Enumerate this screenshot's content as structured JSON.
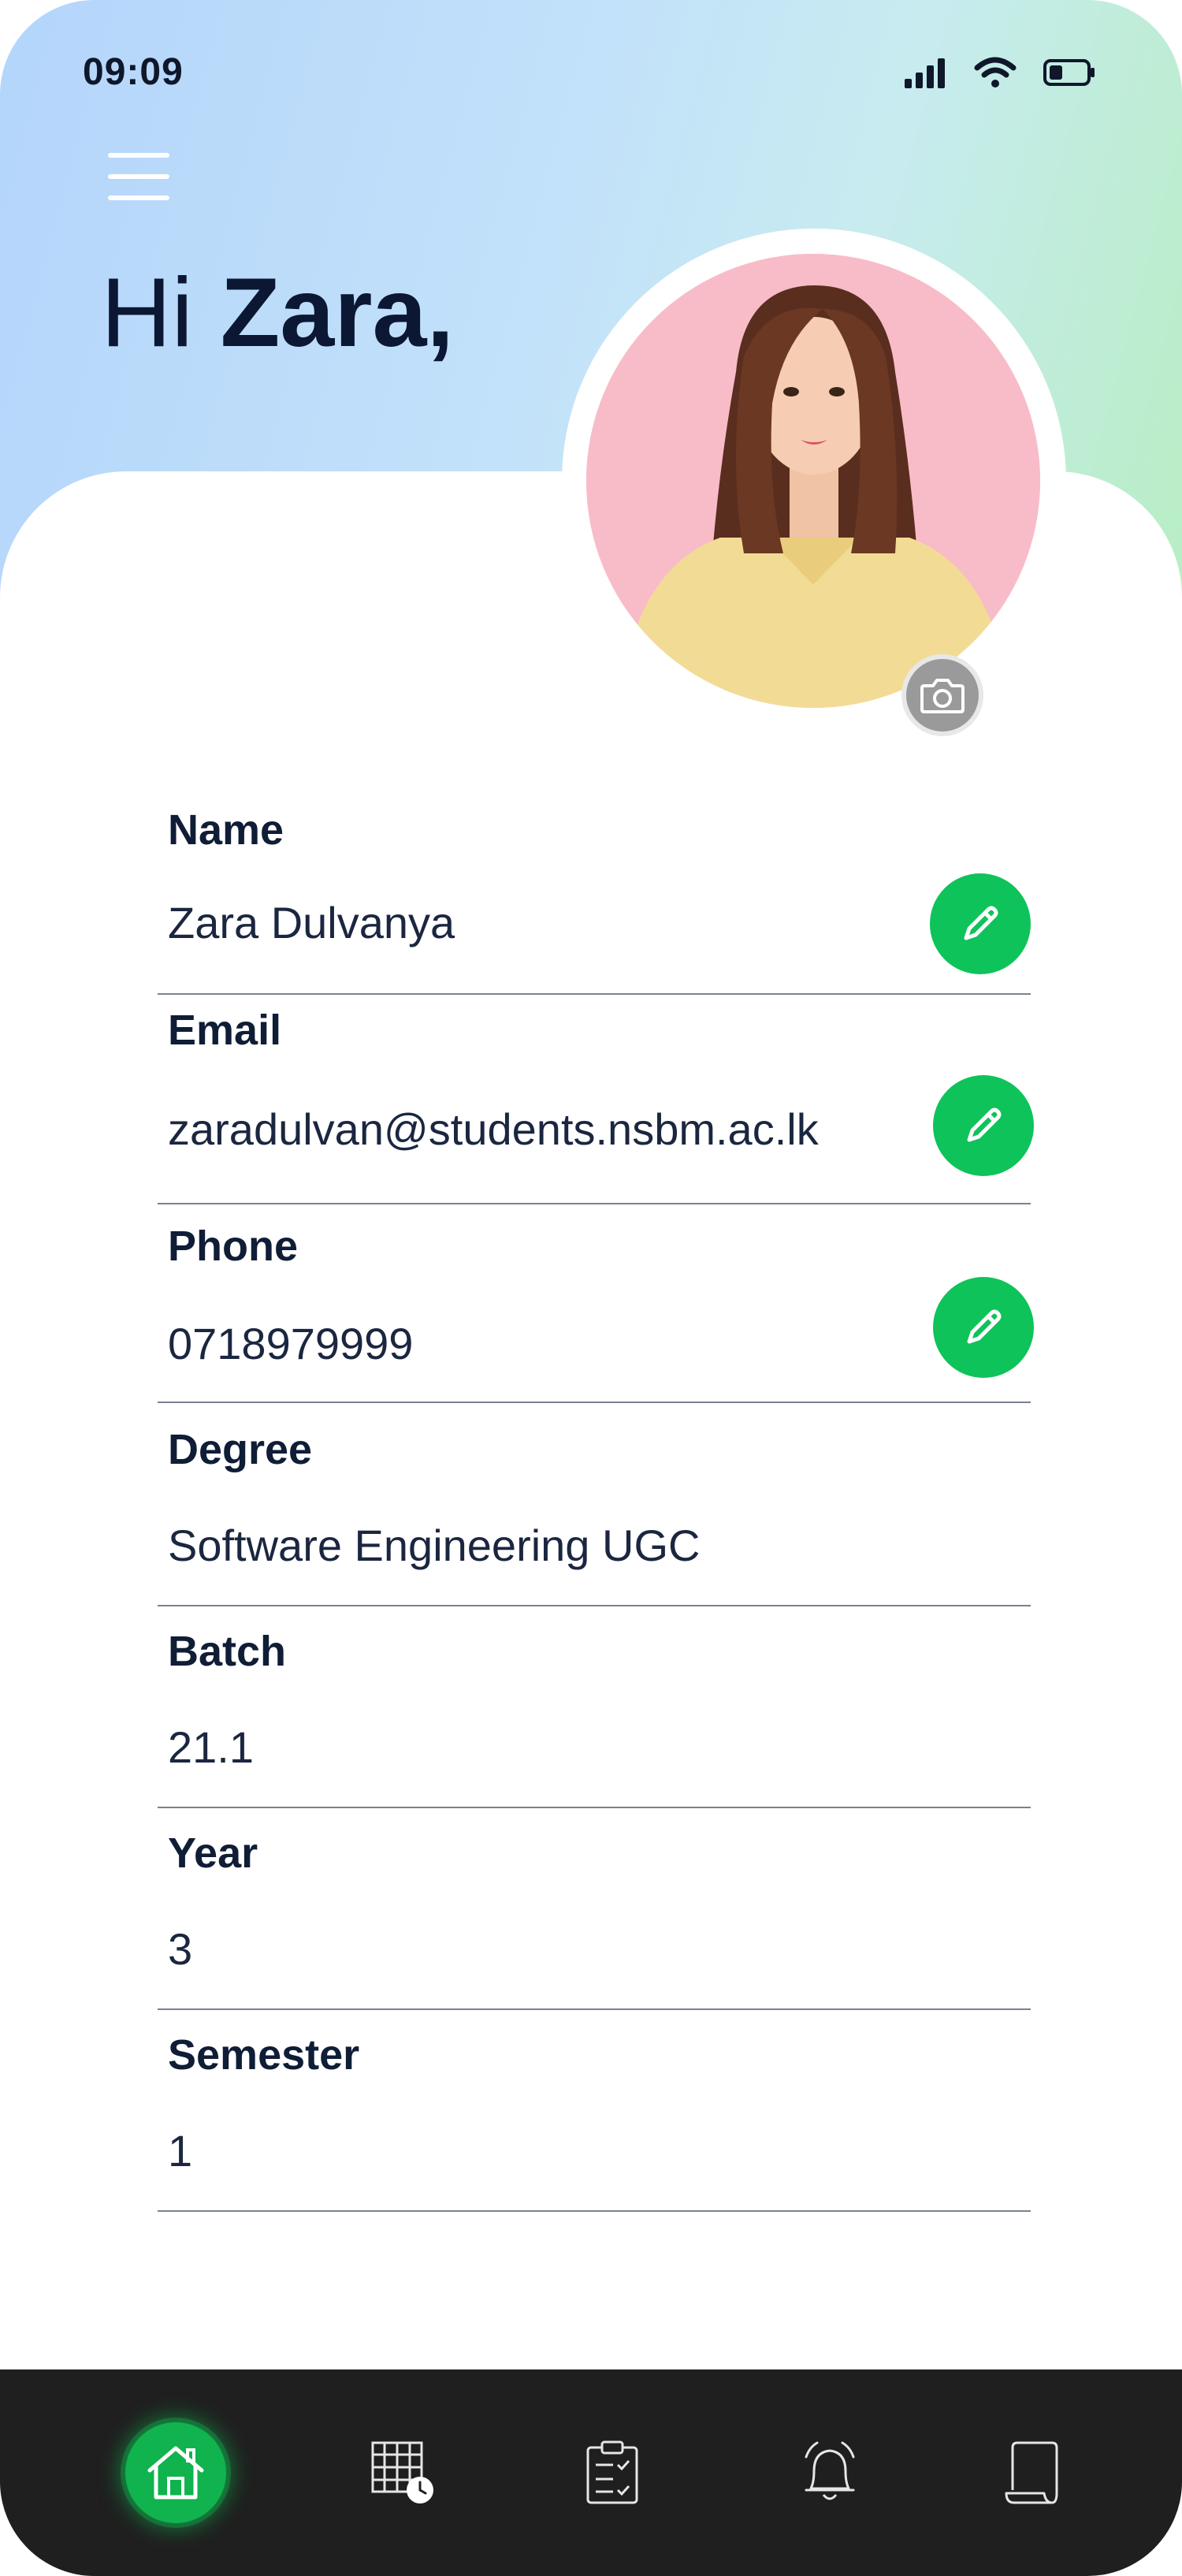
{
  "status_bar": {
    "time": "09:09",
    "icons": [
      "cellular-signal-icon",
      "wifi-icon",
      "battery-icon"
    ]
  },
  "header": {
    "greeting_prefix": "Hi",
    "greeting_name": "Zara,",
    "menu_icon": "hamburger-menu-icon"
  },
  "profile": {
    "camera_icon": "camera-icon"
  },
  "fields": [
    {
      "label": "Name",
      "value": "Zara Dulvanya",
      "editable": true
    },
    {
      "label": "Email",
      "value": "zaradulvan@students.nsbm.ac.lk",
      "editable": true
    },
    {
      "label": "Phone",
      "value": "0718979999",
      "editable": true
    },
    {
      "label": "Degree",
      "value": "Software Engineering UGC",
      "editable": false
    },
    {
      "label": "Batch",
      "value": "21.1",
      "editable": false
    },
    {
      "label": "Year",
      "value": "3",
      "editable": false
    },
    {
      "label": "Semester",
      "value": "1",
      "editable": false
    }
  ],
  "bottom_nav": {
    "items": [
      "home-icon",
      "timetable-icon",
      "tasks-clipboard-icon",
      "notifications-bell-icon",
      "documents-scroll-icon"
    ],
    "active": "home-icon"
  },
  "colors": {
    "accent_green": "#0ec35a",
    "text_dark": "#0f1d36",
    "nav_background": "#1f1f1f"
  }
}
